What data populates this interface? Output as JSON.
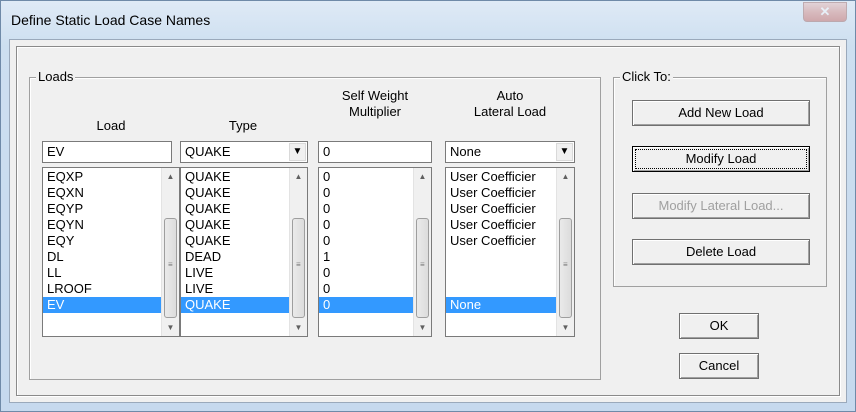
{
  "window": {
    "title": "Define Static Load Case Names",
    "close_label": "✕"
  },
  "loads_group": {
    "legend": "Loads",
    "headers": {
      "load": "Load",
      "type": "Type",
      "self_weight": "Self Weight\nMultiplier",
      "auto_lateral": "Auto\nLateral Load"
    },
    "inputs": {
      "load_value": "EV",
      "type_value": "QUAKE",
      "self_weight_value": "0",
      "auto_lateral_value": "None"
    },
    "load_list": [
      "EQXP",
      "EQXN",
      "EQYP",
      "EQYN",
      "EQY",
      "DL",
      "LL",
      "LROOF",
      "EV"
    ],
    "type_list": [
      "QUAKE",
      "QUAKE",
      "QUAKE",
      "QUAKE",
      "QUAKE",
      "DEAD",
      "LIVE",
      "LIVE",
      "QUAKE"
    ],
    "multiplier_list": [
      "0",
      "0",
      "0",
      "0",
      "0",
      "1",
      "0",
      "0",
      "0"
    ],
    "auto_lateral_list": [
      "User Coefficier",
      "User Coefficier",
      "User Coefficier",
      "User Coefficier",
      "User Coefficier",
      "",
      "",
      "",
      "None"
    ],
    "selected_index": 8
  },
  "click_to_group": {
    "legend": "Click To:",
    "add_new_load": "Add New Load",
    "modify_load": "Modify Load",
    "modify_lateral_load": "Modify Lateral Load...",
    "delete_load": "Delete Load"
  },
  "dialog_buttons": {
    "ok": "OK",
    "cancel": "Cancel"
  }
}
